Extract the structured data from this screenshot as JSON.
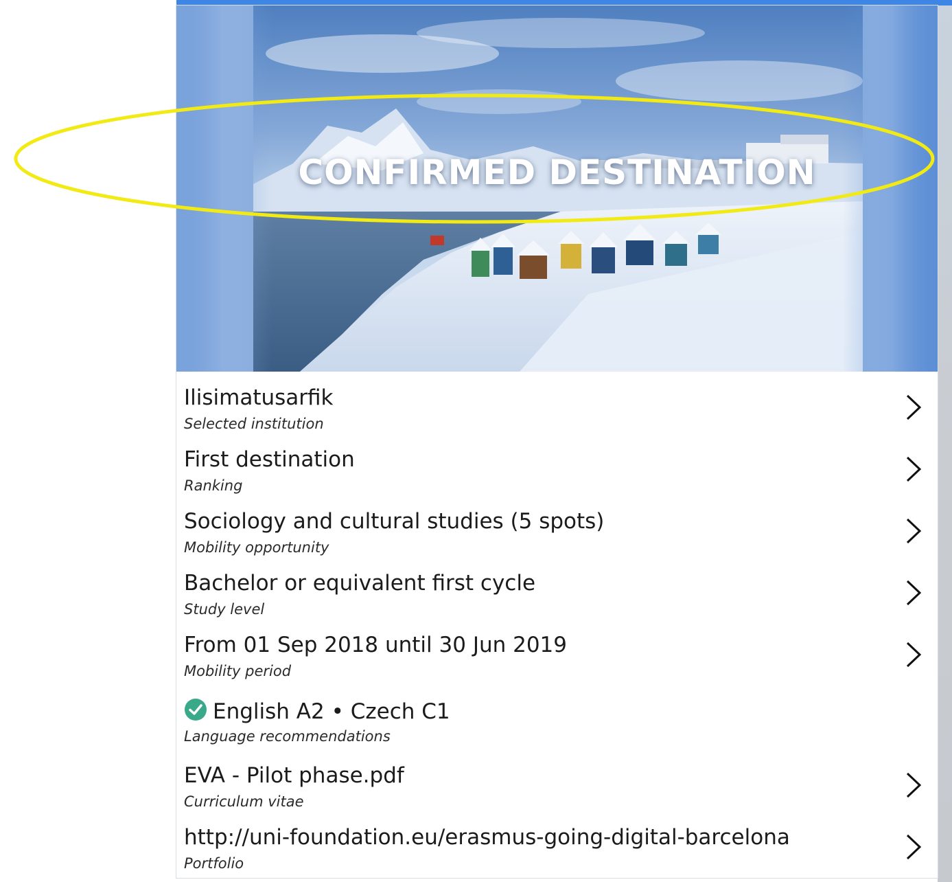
{
  "hero": {
    "title": "CONFIRMED DESTINATION"
  },
  "details": [
    {
      "primary": "Ilisimatusarfik",
      "secondary": "Selected institution",
      "has_chevron": true
    },
    {
      "primary": "First destination",
      "secondary": "Ranking",
      "has_chevron": true
    },
    {
      "primary": "Sociology and cultural studies (5 spots)",
      "secondary": "Mobility opportunity",
      "has_chevron": true
    },
    {
      "primary": "Bachelor or equivalent first cycle",
      "secondary": "Study level",
      "has_chevron": true
    },
    {
      "primary": "From 01 Sep 2018 until 30 Jun 2019",
      "secondary": "Mobility period",
      "has_chevron": true
    },
    {
      "primary": "English A2 • Czech C1",
      "secondary": "Language recommendations",
      "has_chevron": false,
      "icon": "check-circle-icon"
    },
    {
      "primary": "EVA - Pilot phase.pdf",
      "secondary": "Curriculum vitae",
      "has_chevron": true
    },
    {
      "primary": "http://uni-foundation.eu/erasmus-going-digital-barcelona",
      "secondary": "Portfolio",
      "has_chevron": true
    }
  ],
  "colors": {
    "accent_bar": "#3d86e6",
    "check_icon": "#3aa98a",
    "annotation": "#f2ea14",
    "text_primary": "#1b1b1b"
  }
}
